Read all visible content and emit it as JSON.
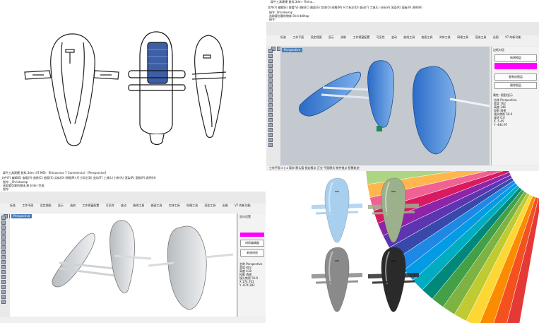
{
  "top_rhino": {
    "title": "犀牛工具建模-鼠标.3dm - Rhino...",
    "menu": [
      "文件(F)",
      "编辑(E)",
      "查看(V)",
      "曲线(C)",
      "曲面(S)",
      "实体(O)",
      "网格(M)",
      "尺寸标注(D)",
      "变动(T)",
      "工具(L)",
      "分析(A)",
      "渲染(R)",
      "面板(P)",
      "说明(H)"
    ],
    "command_lines": [
      "指令: Shrinkwrap",
      "选取要包裹的物体 ShrinkWrap",
      "指令:"
    ],
    "tabs": [
      "标准",
      "工作平面",
      "设定视图",
      "显示",
      "选取",
      "工作视窗配置",
      "可见性",
      "变动",
      "曲线工具",
      "曲面工具",
      "实体工具",
      "网格工具",
      "渲染工具",
      "出图",
      "V7 的新功能"
    ],
    "viewport_label": "Perspective",
    "right_panel": {
      "header": "边框对话",
      "buttons": [
        "新增图层",
        "复制成图层",
        "删除图层"
      ],
      "props_header": "属性: 视图/显示",
      "rows": [
        [
          "名称",
          "Perspective"
        ],
        [
          "宽度",
          "762"
        ],
        [
          "高度",
          "346"
        ],
        [
          "投影",
          "透视"
        ],
        [
          "镜头焦距",
          "50.0"
        ],
        [
          "旋转",
          "0.0"
        ],
        [
          "X",
          "-5.45"
        ],
        [
          "Y",
          "-444.97"
        ]
      ]
    },
    "status": [
      "工作平面",
      "x",
      "y",
      "z",
      "毫米",
      "默认值",
      "锁定格点",
      "正交",
      "平面模式",
      "物件锁点",
      "智慧轨迹"
    ],
    "accent": "#ff00ff"
  },
  "bottom_rhino": {
    "title": "犀牛工具建模-鼠标.3dm (47 MB) - Rhinoceros 7 Commercial - [Perspective]",
    "menu": [
      "文件(F)",
      "编辑(E)",
      "查看(V)",
      "曲线(C)",
      "曲面(S)",
      "实体(O)",
      "网格(M)",
      "尺寸标注(D)",
      "变动(T)",
      "工具(L)",
      "分析(A)",
      "渲染(R)",
      "面板(P)",
      "说明(H)"
    ],
    "command_lines": [
      "指令: _Shrinkwrap",
      "选取要包裹的物体,按 Enter 完成",
      "指令:"
    ],
    "tabs": [
      "标准",
      "工作平面",
      "设定视图",
      "显示",
      "选取",
      "工作视窗配置",
      "可见性",
      "变动",
      "曲线工具",
      "曲面工具",
      "实体工具",
      "网格工具",
      "渲染工具",
      "出图",
      "V7 的新功能"
    ],
    "viewport_label": "Perspective",
    "right_panel": {
      "header": "显示设置",
      "buttons": [
        "材质编辑器",
        "新增材质"
      ],
      "rows": [
        [
          "名称",
          "Perspective"
        ],
        [
          "宽度",
          "802"
        ],
        [
          "高度",
          "418"
        ],
        [
          "投影",
          "透视"
        ],
        [
          "镜头焦距",
          "50.0"
        ],
        [
          "X",
          "174.701"
        ],
        [
          "Y",
          "-874.282"
        ]
      ]
    },
    "accent": "#ff00ff"
  },
  "color_variants": [
    {
      "name": "light-blue",
      "color": "#a9cfee"
    },
    {
      "name": "sage-green",
      "color": "#9db08c"
    },
    {
      "name": "grey",
      "color": "#8a8a8a"
    },
    {
      "name": "black",
      "color": "#2a2a2a"
    }
  ],
  "swatch_colors": [
    "#e53935",
    "#f4511e",
    "#fb8c00",
    "#fdd835",
    "#c0ca33",
    "#7cb342",
    "#43a047",
    "#00897b",
    "#00acc1",
    "#039be5",
    "#1e88e5",
    "#3949ab",
    "#5e35b1",
    "#8e24aa",
    "#d81b60",
    "#f06292",
    "#ffb74d",
    "#aed581",
    "#4dd0e1",
    "#9575cd"
  ]
}
